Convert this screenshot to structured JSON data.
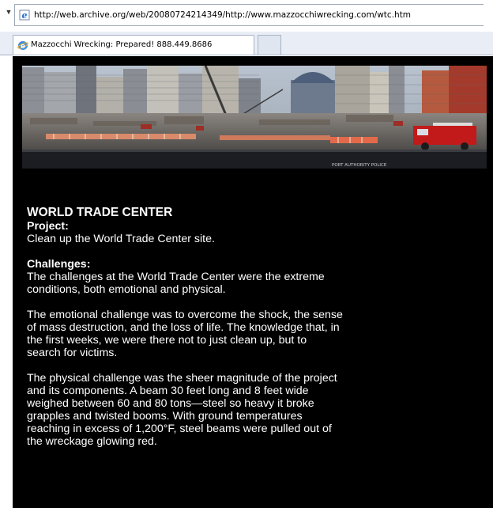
{
  "browser": {
    "address_url": "http://web.archive.org/web/20080724214349/http://www.mazzocchiwrecking.com/wtc.htm",
    "tab_title": "Mazzocchi Wrecking: Prepared! 888.449.8686"
  },
  "banner": {
    "sign_text": "PORT AUTHORITY POLICE"
  },
  "article": {
    "title": "WORLD TRADE CENTER",
    "project_heading": "Project:",
    "project_text": "Clean up the World Trade Center site.",
    "challenges_heading": "Challenges:",
    "paragraphs": [
      "The challenges at the World Trade Center were the extreme conditions, both emotional and physical.",
      "The emotional challenge was to overcome the shock, the sense of mass destruction, and the loss of life. The knowledge that, in the first weeks, we were there not to just clean up, but to search for victims.",
      "The physical challenge was the sheer magnitude of the project and its components. A beam 30 feet long and 8 feet wide weighed between 60 and 80 tons—steel so heavy it broke grapples and twisted booms. With ground temperatures reaching in excess of 1,200°F, steel beams were pulled out of the wreckage glowing red."
    ]
  },
  "colors": {
    "page_background": "#000000",
    "text": "#ffffff",
    "tab_strip": "#e9eef6"
  }
}
